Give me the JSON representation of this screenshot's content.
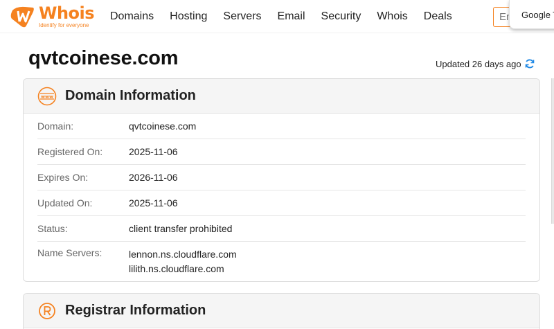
{
  "logo": {
    "name": "Whois",
    "tagline": "Identify for everyone"
  },
  "nav": [
    "Domains",
    "Hosting",
    "Servers",
    "Email",
    "Security",
    "Whois",
    "Deals"
  ],
  "search": {
    "value": "En"
  },
  "translate_popup": {
    "label": "Google Tr"
  },
  "page": {
    "domain": "qvtcoinese.com",
    "updated_text": "Updated 26 days ago"
  },
  "domain_info": {
    "title": "Domain Information",
    "rows": [
      {
        "label": "Domain:",
        "value": "qvtcoinese.com"
      },
      {
        "label": "Registered On:",
        "value": "2025-11-06"
      },
      {
        "label": "Expires On:",
        "value": "2026-11-06"
      },
      {
        "label": "Updated On:",
        "value": "2025-11-06"
      },
      {
        "label": "Status:",
        "value": "client transfer prohibited"
      },
      {
        "label": "Name Servers:",
        "values": [
          "lennon.ns.cloudflare.com",
          "lilith.ns.cloudflare.com"
        ]
      }
    ]
  },
  "registrar_info": {
    "title": "Registrar Information"
  },
  "colors": {
    "brand": "#f58220",
    "accent_blue": "#1e88e5"
  }
}
